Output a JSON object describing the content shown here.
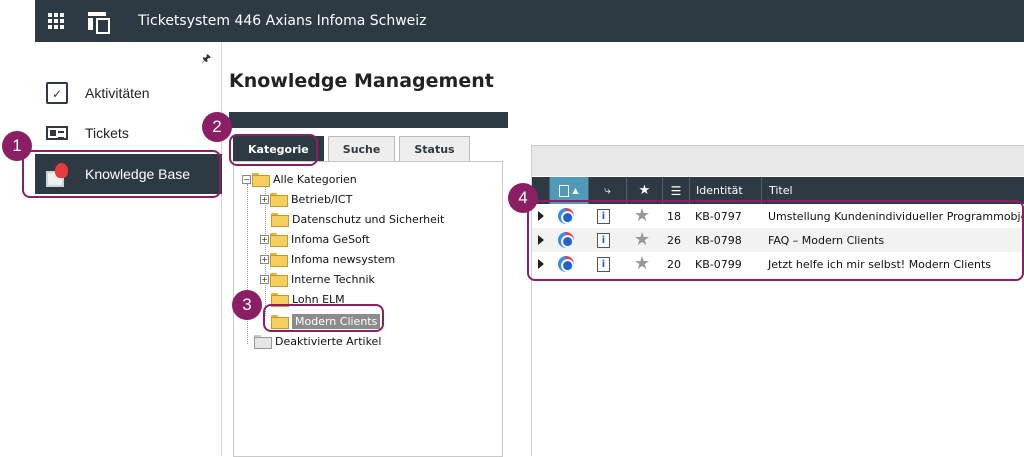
{
  "app": {
    "title": "Ticketsystem 446 Axians Infoma Schweiz",
    "pin_glyph": "🖈"
  },
  "sidebar": {
    "items": [
      {
        "label": "Aktivitäten",
        "icon": "clipboard-check-icon",
        "active": false
      },
      {
        "label": "Tickets",
        "icon": "ticket-card-icon",
        "active": false
      },
      {
        "label": "Knowledge Base",
        "icon": "knowledge-base-icon",
        "active": true
      }
    ]
  },
  "main": {
    "title": "Knowledge Management",
    "tabs": [
      {
        "label": "Kategorie",
        "active": true
      },
      {
        "label": "Suche",
        "active": false
      },
      {
        "label": "Status",
        "active": false
      }
    ],
    "tree": {
      "root": "Alle Kategorien",
      "children": [
        {
          "label": "Betrieb/ICT",
          "expandable": true
        },
        {
          "label": "Datenschutz und Sicherheit",
          "expandable": false
        },
        {
          "label": "Infoma GeSoft",
          "expandable": true
        },
        {
          "label": "Infoma newsystem",
          "expandable": true
        },
        {
          "label": "Interne Technik",
          "expandable": true
        },
        {
          "label": "Lohn ELM",
          "expandable": false
        },
        {
          "label": "Modern Clients",
          "expandable": false,
          "selected": true
        }
      ],
      "deactivated": "Deaktivierte Artikel",
      "expand_symbol": "+",
      "collapse_symbol": "−"
    }
  },
  "grid": {
    "header_star": "★",
    "columns": [
      "Identität",
      "Titel"
    ],
    "rows": [
      {
        "count": "18",
        "id": "KB-0797",
        "title": "Umstellung Kundenindividueller Programmobjekt..."
      },
      {
        "count": "26",
        "id": "KB-0798",
        "title": "FAQ – Modern Clients"
      },
      {
        "count": "20",
        "id": "KB-0799",
        "title": "Jetzt helfe ich mir selbst! Modern Clients"
      }
    ],
    "info_glyph": "i",
    "star_glyph": "★"
  },
  "callouts": [
    "1",
    "2",
    "3",
    "4"
  ],
  "colors": {
    "header": "#2e3a43",
    "accent": "#8c1e63",
    "sorted_column": "#4e9ab8",
    "selected_node": "#8c8c8c"
  }
}
